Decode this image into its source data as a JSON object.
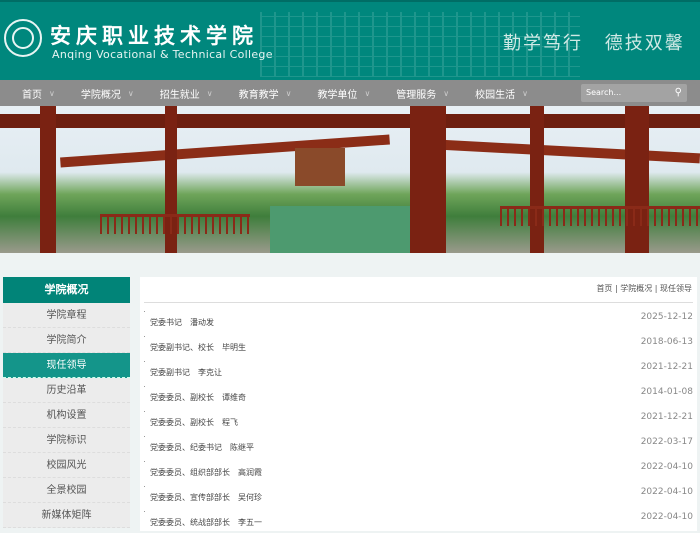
{
  "header": {
    "title_cn": "安庆职业技术学院",
    "title_en": "Anqing Vocational & Technical College",
    "motto": "勤学笃行 德技双馨"
  },
  "nav": {
    "items": [
      "首页",
      "学院概况",
      "招生就业",
      "教育教学",
      "教学单位",
      "管理服务",
      "校园生活"
    ],
    "search_placeholder": "Search..."
  },
  "sidebar": {
    "title": "学院概况",
    "items": [
      {
        "label": "学院章程"
      },
      {
        "label": "学院简介"
      },
      {
        "label": "现任领导",
        "active": true
      },
      {
        "label": "历史沿革"
      },
      {
        "label": "机构设置"
      },
      {
        "label": "学院标识"
      },
      {
        "label": "校园风光"
      },
      {
        "label": "全景校园"
      },
      {
        "label": "新媒体矩阵"
      }
    ]
  },
  "breadcrumb": "首页 | 学院概况 | 现任领导",
  "list": [
    {
      "title": "党委书记　潘动发",
      "date": "2025-12-12"
    },
    {
      "title": "党委副书记、校长　毕明生",
      "date": "2018-06-13"
    },
    {
      "title": "党委副书记　李克让",
      "date": "2021-12-21"
    },
    {
      "title": "党委委员、副校长　谭维奇",
      "date": "2014-01-08"
    },
    {
      "title": "党委委员、副校长　程飞",
      "date": "2021-12-21"
    },
    {
      "title": "党委委员、纪委书记　陈继平",
      "date": "2022-03-17"
    },
    {
      "title": "党委委员、组织部部长　高润霞",
      "date": "2022-04-10"
    },
    {
      "title": "党委委员、宣传部部长　吴何珍",
      "date": "2022-04-10"
    },
    {
      "title": "党委委员、统战部部长　李五一",
      "date": "2022-04-10"
    }
  ],
  "colors": {
    "brand": "#00877d",
    "nav": "#8c8c8c",
    "active": "#14958a"
  }
}
